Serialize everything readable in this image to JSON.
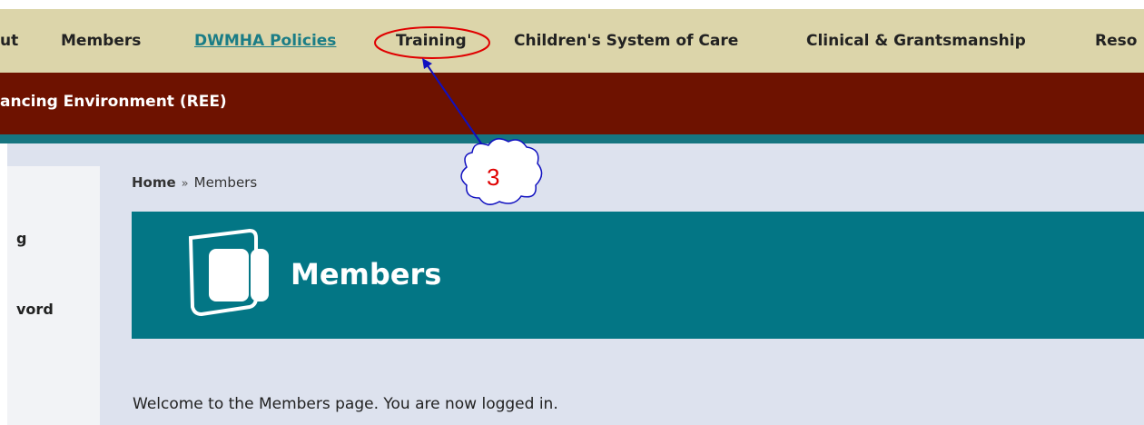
{
  "nav": {
    "items": [
      {
        "label": "ut"
      },
      {
        "label": "Members"
      },
      {
        "label": "DWMHA Policies"
      },
      {
        "label": "Training"
      },
      {
        "label": "Children's System of Care"
      },
      {
        "label": "Clinical & Grantsmanship"
      },
      {
        "label": "Reso"
      }
    ]
  },
  "banner": {
    "text": "ancing Environment (REE)"
  },
  "sidebar": {
    "items": [
      {
        "label": "g"
      },
      {
        "label": "vord"
      }
    ]
  },
  "breadcrumb": {
    "home": "Home",
    "separator": "»",
    "current": "Members"
  },
  "page": {
    "title": "Members",
    "welcome": "Welcome to the Members page. You are now logged in."
  },
  "annotation": {
    "number": "3",
    "color": "#e00000",
    "arrow_color": "#1010c0"
  },
  "colors": {
    "nav_bg": "#dcd5aa",
    "banner_bg": "#6e1200",
    "teal": "#037685",
    "content_bg": "#dde2ee",
    "active_link": "#1b7d86"
  }
}
